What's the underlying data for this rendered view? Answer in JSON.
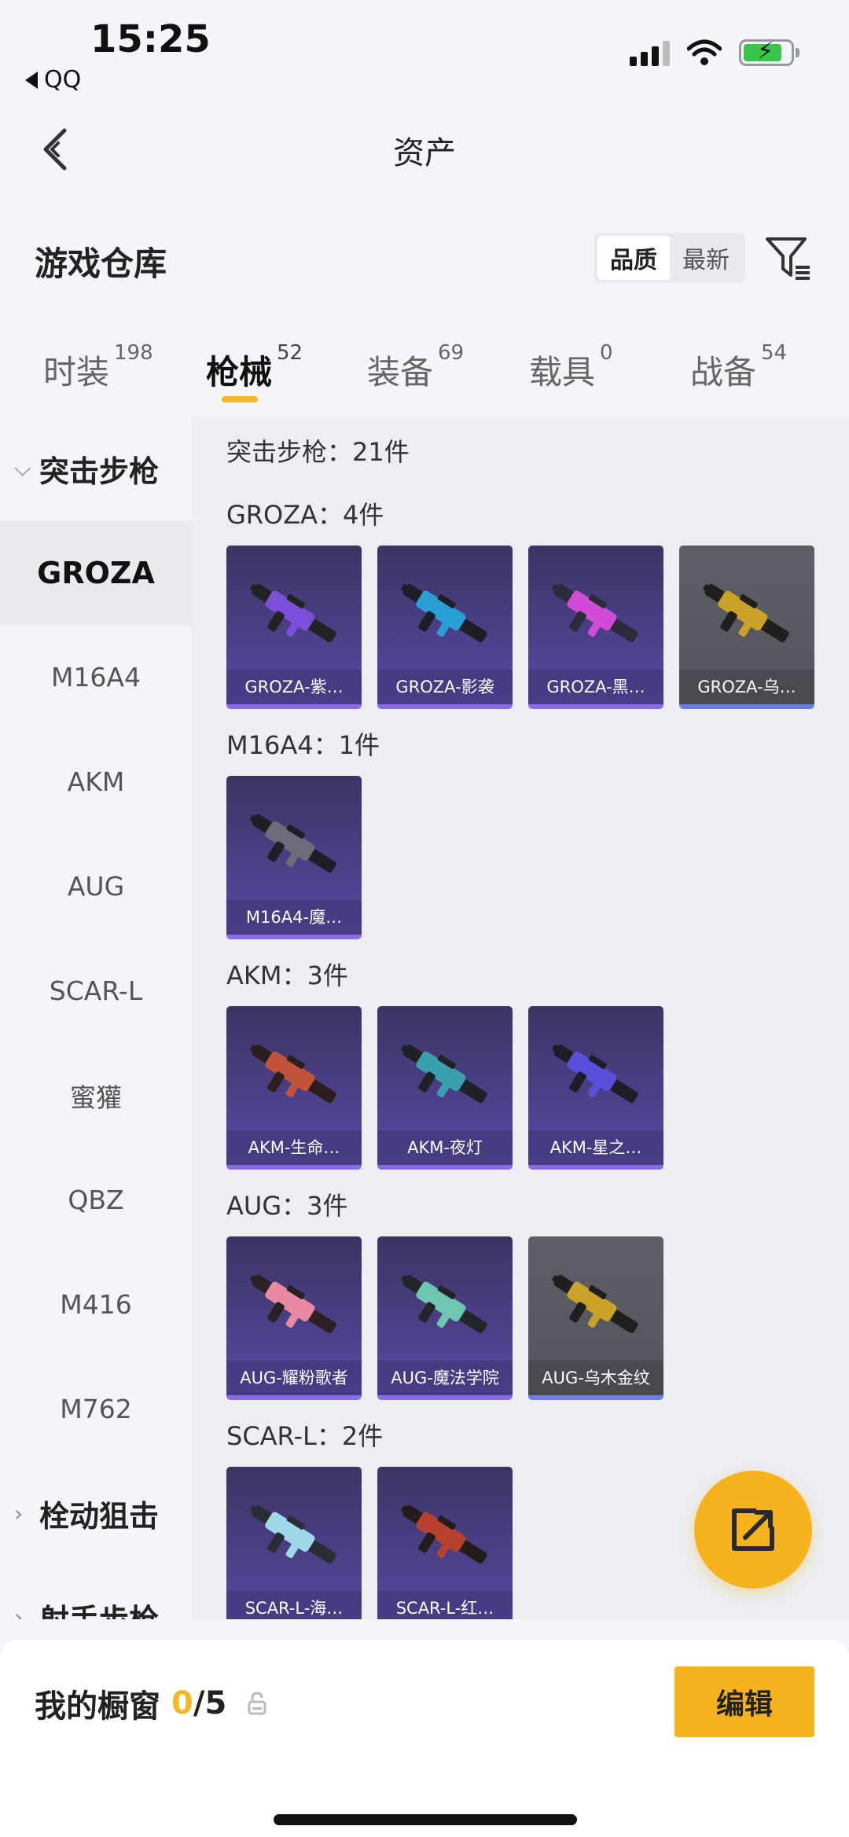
{
  "status": {
    "time": "15:25",
    "back_app": "QQ"
  },
  "nav": {
    "title": "资产"
  },
  "warehouse": {
    "title": "游戏仓库",
    "sort_options": [
      "品质",
      "最新"
    ],
    "sort_selected": "品质"
  },
  "tabs": [
    {
      "label": "时装",
      "count": "198"
    },
    {
      "label": "枪械",
      "count": "52"
    },
    {
      "label": "装备",
      "count": "69"
    },
    {
      "label": "载具",
      "count": "0"
    },
    {
      "label": "战备",
      "count": "54"
    }
  ],
  "active_tab": "枪械",
  "sidebar": {
    "group_open": "突击步枪",
    "items": [
      "GROZA",
      "M16A4",
      "AKM",
      "AUG",
      "SCAR-L",
      "蜜獾",
      "QBZ",
      "M416",
      "M762"
    ],
    "active_item": "GROZA",
    "group_2": "栓动狙击",
    "group_3": "射手步枪"
  },
  "content": {
    "summary": "突击步枪：21件",
    "categories": [
      {
        "header": "GROZA：4件",
        "items": [
          {
            "label": "GROZA-紫…",
            "rarity": "purple"
          },
          {
            "label": "GROZA-影袭",
            "rarity": "purple"
          },
          {
            "label": "GROZA-黑…",
            "rarity": "purple"
          },
          {
            "label": "GROZA-乌…",
            "rarity": "grey"
          }
        ]
      },
      {
        "header": "M16A4：1件",
        "items": [
          {
            "label": "M16A4-魔…",
            "rarity": "purple"
          }
        ]
      },
      {
        "header": "AKM：3件",
        "items": [
          {
            "label": "AKM-生命…",
            "rarity": "purple"
          },
          {
            "label": "AKM-夜灯",
            "rarity": "purple"
          },
          {
            "label": "AKM-星之…",
            "rarity": "purple"
          }
        ]
      },
      {
        "header": "AUG：3件",
        "items": [
          {
            "label": "AUG-耀粉歌者",
            "rarity": "purple"
          },
          {
            "label": "AUG-魔法学院",
            "rarity": "purple"
          },
          {
            "label": "AUG-乌木金纹",
            "rarity": "grey"
          }
        ]
      },
      {
        "header": "SCAR-L：2件",
        "items": [
          {
            "label": "SCAR-L-海…",
            "rarity": "purple"
          },
          {
            "label": "SCAR-L-红…",
            "rarity": "purple"
          }
        ]
      }
    ]
  },
  "bottom": {
    "showcase_label": "我的橱窗",
    "showcase_used": "0",
    "showcase_total": "/5",
    "edit_label": "编辑"
  },
  "colors": {
    "accent": "#f7b31d",
    "tab_underline": "#f5b821",
    "card_purple": "#4b3f86",
    "card_grey": "#56565e"
  }
}
